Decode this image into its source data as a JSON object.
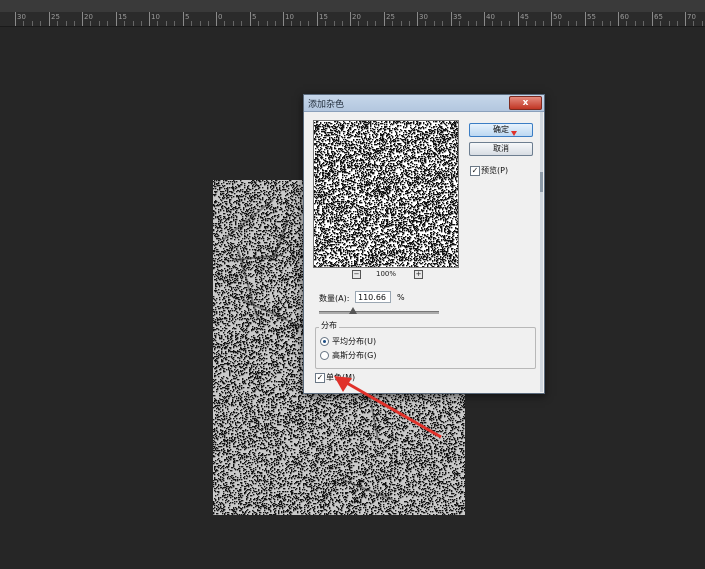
{
  "ruler": {
    "labels": [
      "30",
      "25",
      "20",
      "15",
      "10",
      "5",
      "0",
      "5",
      "10",
      "15",
      "20",
      "25",
      "30",
      "35",
      "40",
      "45",
      "50",
      "55",
      "60",
      "65",
      "70"
    ]
  },
  "dialog": {
    "title": "添加杂色",
    "close_label": "x",
    "ok_label": "确定",
    "cancel_label": "取消",
    "preview_label": "预览(P)",
    "preview_checked": true,
    "zoom_minus": "−",
    "zoom_plus": "+",
    "zoom_value": "100%",
    "amount_label": "数量(A):",
    "amount_value": "110.66",
    "amount_unit": "%",
    "distribution": {
      "legend": "分布",
      "options": [
        {
          "label": "平均分布(U)",
          "selected": true
        },
        {
          "label": "高斯分布(G)",
          "selected": false
        }
      ]
    },
    "monochromatic_label": "单色(M)",
    "monochromatic_checked": true
  },
  "colors": {
    "annotation_arrow": "#e0312a",
    "workspace_bg": "#262626",
    "dialog_bg": "#f0f0f0"
  }
}
